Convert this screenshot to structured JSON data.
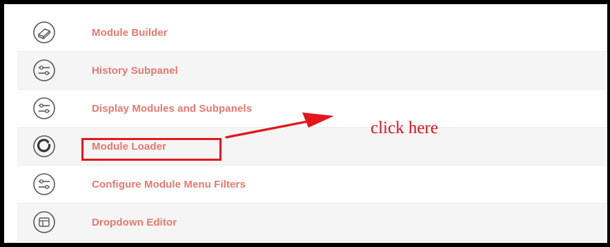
{
  "menu": {
    "items": [
      {
        "label": "Module Builder",
        "icon": "module-builder-icon"
      },
      {
        "label": "History Subpanel",
        "icon": "sliders-icon"
      },
      {
        "label": "Display Modules and Subpanels",
        "icon": "sliders-icon"
      },
      {
        "label": "Module Loader",
        "icon": "module-loader-icon"
      },
      {
        "label": "Configure Module Menu Filters",
        "icon": "sliders-icon"
      },
      {
        "label": "Dropdown Editor",
        "icon": "dropdown-editor-icon"
      }
    ]
  },
  "annotation": {
    "text": "click here",
    "color": "#d8141c"
  },
  "colors": {
    "link": "#e8786e",
    "highlight": "#e3161b"
  }
}
